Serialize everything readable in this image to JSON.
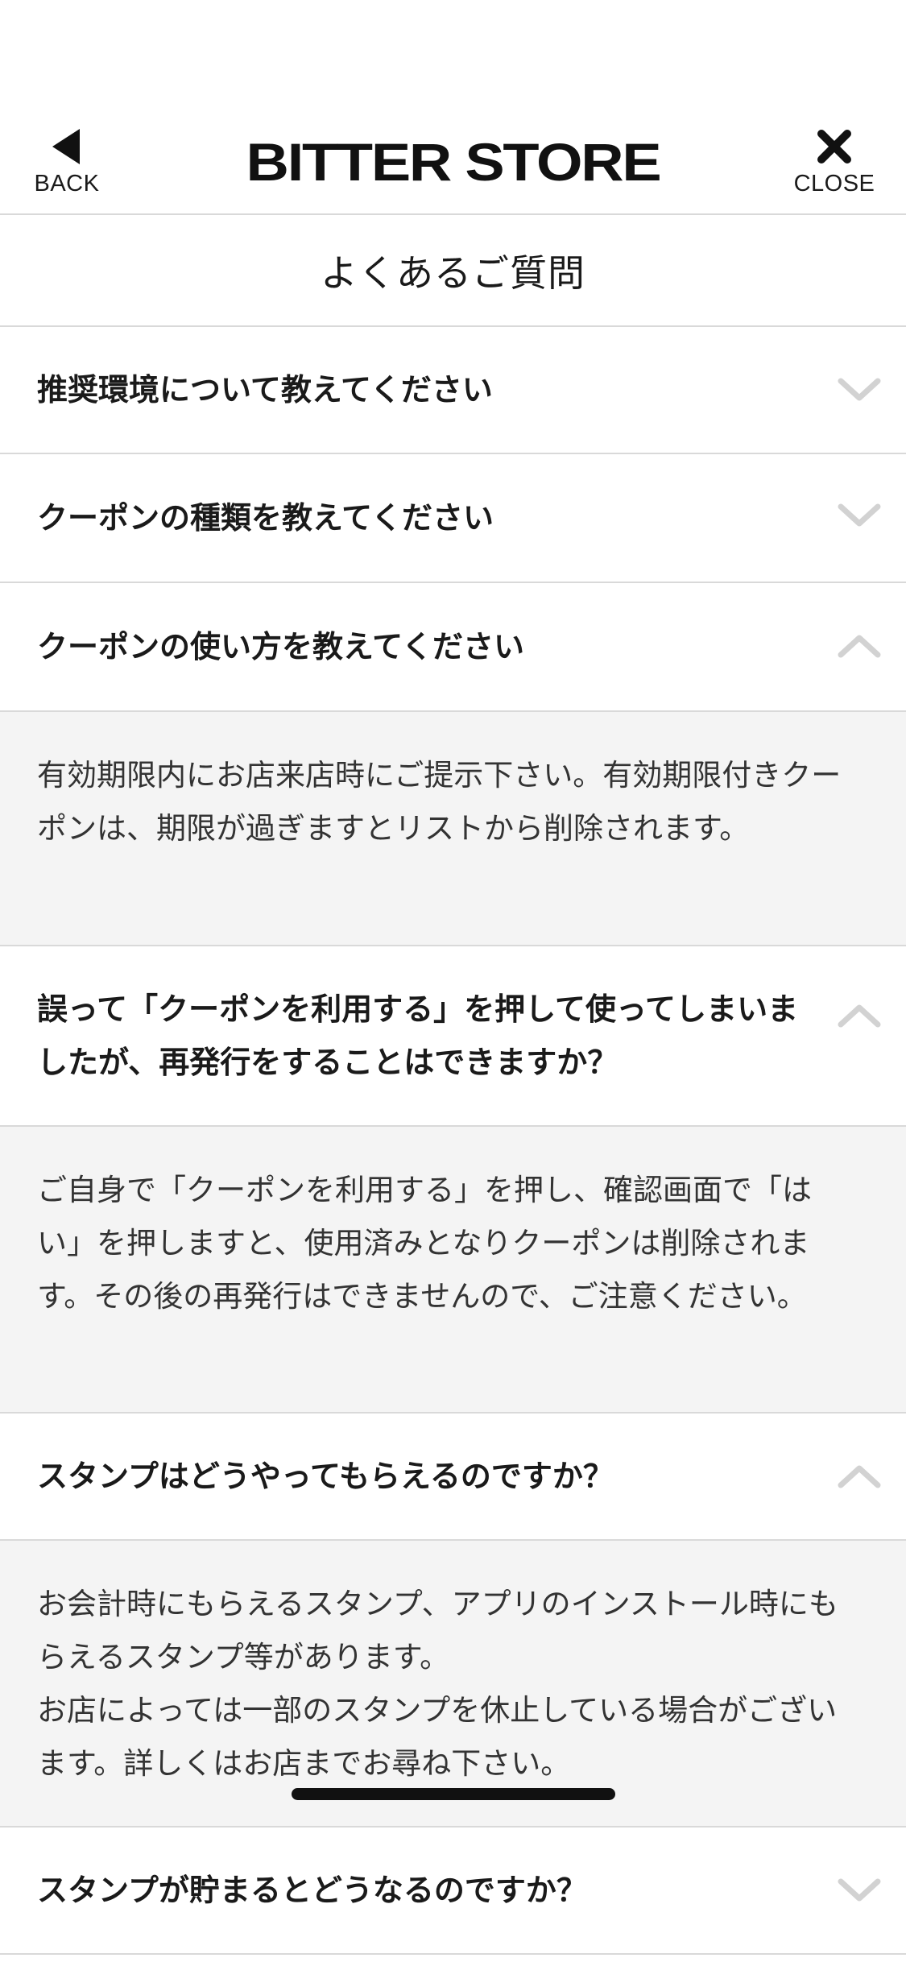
{
  "header": {
    "back_label": "BACK",
    "logo_text": "BITTER STORE",
    "close_label": "CLOSE"
  },
  "page": {
    "title": "よくあるご質問"
  },
  "faq": [
    {
      "question": "推奨環境について教えてください",
      "expanded": false,
      "icon": "chevron-down-icon"
    },
    {
      "question": "クーポンの種類を教えてください",
      "expanded": false,
      "icon": "chevron-down-icon"
    },
    {
      "question": "クーポンの使い方を教えてください",
      "expanded": true,
      "icon": "chevron-up-icon",
      "answer": "有効期限内にお店来店時にご提示下さい。有効期限付きクーポンは、期限が過ぎますとリストから削除されます。"
    },
    {
      "question": "誤って「クーポンを利用する」を押して使ってしまいましたが、再発行をすることはできますか？",
      "expanded": true,
      "icon": "chevron-up-icon",
      "answer": "ご自身で「クーポンを利用する」を押し、確認画面で「はい」を押しますと、使用済みとなりクーポンは削除されます。その後の再発行はできませんので、ご注意ください。"
    },
    {
      "question": "スタンプはどうやってもらえるのですか？",
      "expanded": true,
      "icon": "chevron-up-icon",
      "answer": "お会計時にもらえるスタンプ、アプリのインストール時にもらえるスタンプ等があります。\nお店によっては一部のスタンプを休止している場合がございます。詳しくはお店までお尋ね下さい。"
    },
    {
      "question": "スタンプが貯まるとどうなるのですか？",
      "expanded": false,
      "icon": "chevron-down-icon"
    }
  ],
  "colors": {
    "divider": "#d9d9d9",
    "answer_background": "#f4f4f4",
    "chevron": "#d2d2d2",
    "text": "#1a1a1a"
  }
}
